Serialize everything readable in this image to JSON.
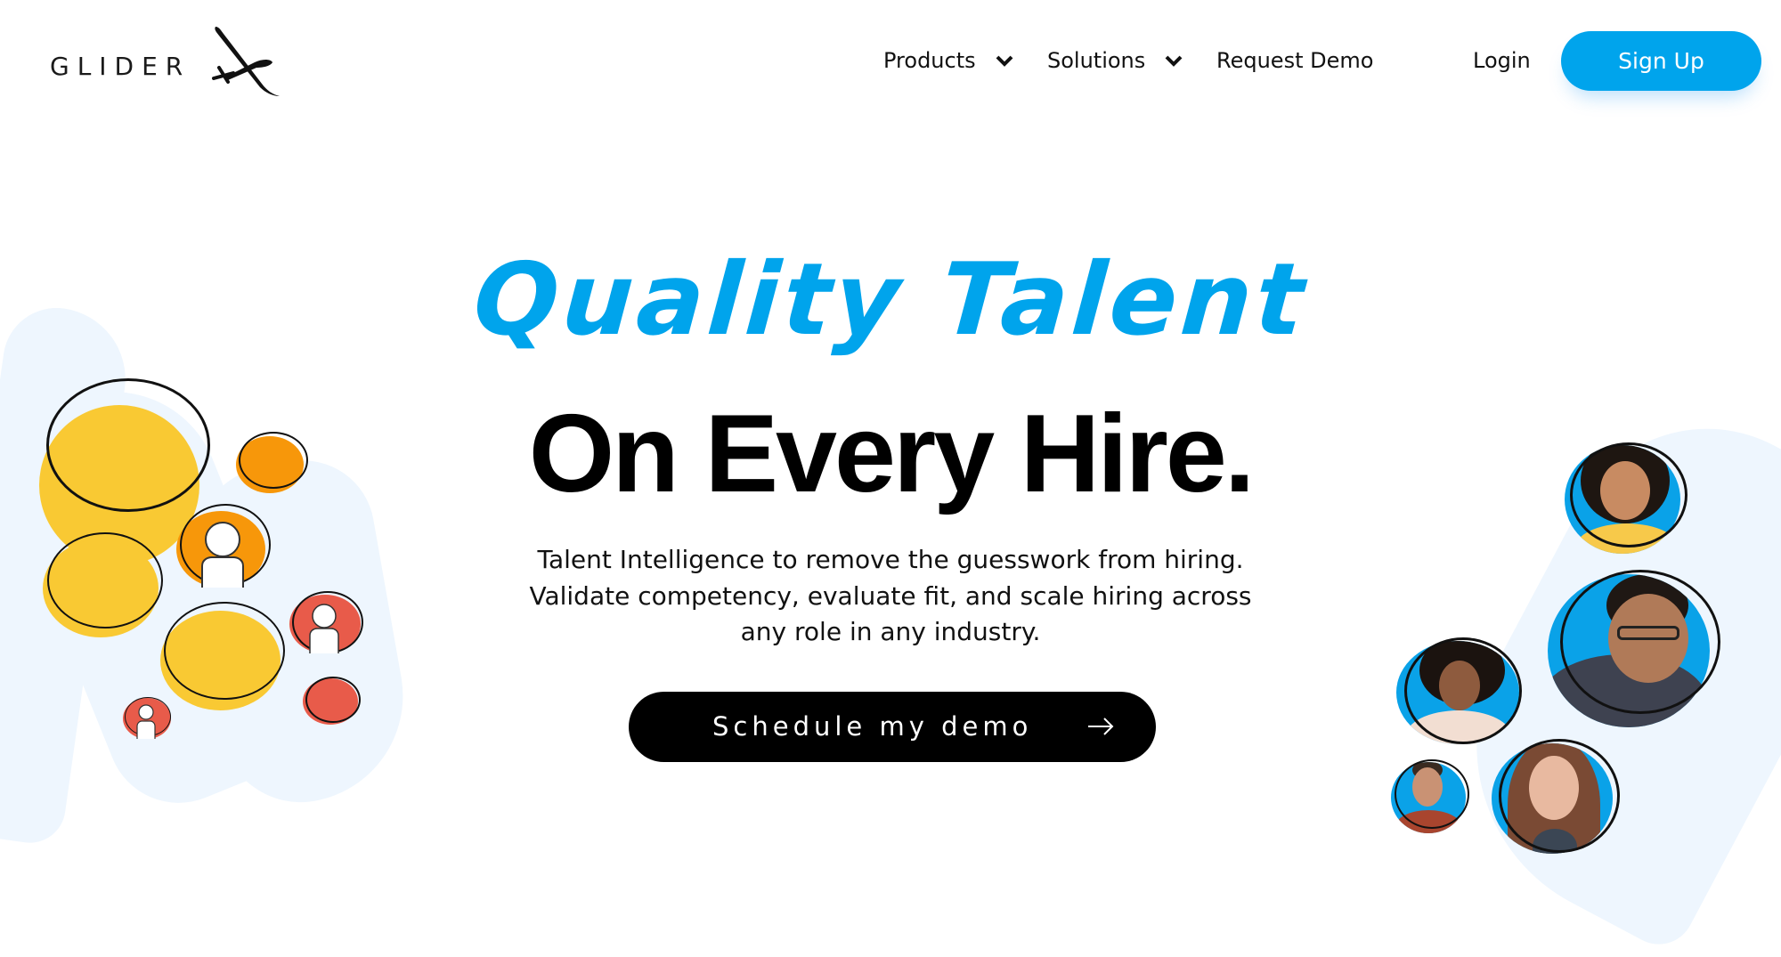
{
  "brand": {
    "name": "GLIDER",
    "logo_icon": "glider-plane-icon",
    "accent_color": "#00A4EC"
  },
  "nav": {
    "items": [
      {
        "label": "Products",
        "has_dropdown": true,
        "icon": "chevron-down-icon"
      },
      {
        "label": "Solutions",
        "has_dropdown": true,
        "icon": "chevron-down-icon"
      },
      {
        "label": "Request Demo",
        "has_dropdown": false
      }
    ],
    "login_label": "Login",
    "signup_label": "Sign Up"
  },
  "hero": {
    "headline_accent": "Quality Talent",
    "headline_main": "On Every Hire.",
    "body": "Talent Intelligence to remove the guesswork from hiring. Validate competency, evaluate fit, and scale hiring across any role in any industry.",
    "cta_label": "Schedule my demo",
    "cta_icon": "arrow-right-icon"
  },
  "decor": {
    "colors": {
      "yellow": "#F9C933",
      "orange": "#F7970A",
      "red": "#E85B4A",
      "brush": "#EEF6FE",
      "avatar_bg": "#0AA2E8"
    },
    "left_cluster": [
      "yellow-circle",
      "orange-circle",
      "orange-person-circle",
      "yellow-circle",
      "yellow-circle",
      "red-person-circle",
      "red-circle",
      "red-person-circle"
    ],
    "right_cluster": [
      "avatar-woman-curly-hair",
      "avatar-man-glasses",
      "avatar-woman-glasses",
      "avatar-man-short-hair",
      "avatar-woman-long-hair"
    ]
  }
}
